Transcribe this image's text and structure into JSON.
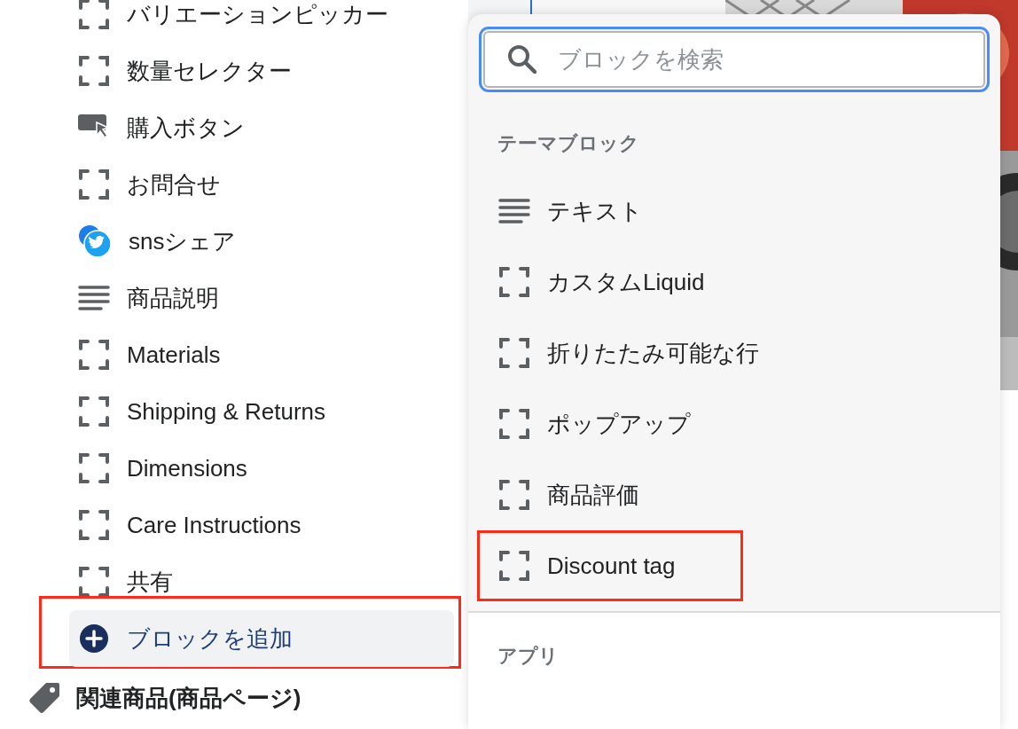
{
  "sidebar": {
    "blocks": [
      {
        "label": "バリエーションピッカー",
        "kind": "block"
      },
      {
        "label": "数量セレクター",
        "kind": "block"
      },
      {
        "label": "購入ボタン",
        "kind": "button"
      },
      {
        "label": "お問合せ",
        "kind": "block"
      },
      {
        "label": "snsシェア",
        "kind": "social"
      },
      {
        "label": "商品説明",
        "kind": "text"
      },
      {
        "label": "Materials",
        "kind": "block"
      },
      {
        "label": "Shipping & Returns",
        "kind": "block"
      },
      {
        "label": "Dimensions",
        "kind": "block"
      },
      {
        "label": "Care Instructions",
        "kind": "block"
      },
      {
        "label": "共有",
        "kind": "block"
      }
    ],
    "add_block": {
      "label": "ブロックを追加",
      "highlighted": true
    },
    "next_section": {
      "label": "関連商品(商品ページ)"
    }
  },
  "block_picker": {
    "search": {
      "placeholder": "ブロックを検索"
    },
    "sections": [
      {
        "title": "テーマブロック",
        "items": [
          {
            "label": "テキスト",
            "kind": "text",
            "highlighted": false
          },
          {
            "label": "カスタムLiquid",
            "kind": "block",
            "highlighted": false
          },
          {
            "label": "折りたたみ可能な行",
            "kind": "block",
            "highlighted": false
          },
          {
            "label": "ポップアップ",
            "kind": "block",
            "highlighted": false
          },
          {
            "label": "商品評価",
            "kind": "block",
            "highlighted": false
          },
          {
            "label": "Discount tag",
            "kind": "block",
            "highlighted": true
          }
        ]
      },
      {
        "title": "アプリ"
      }
    ]
  }
}
